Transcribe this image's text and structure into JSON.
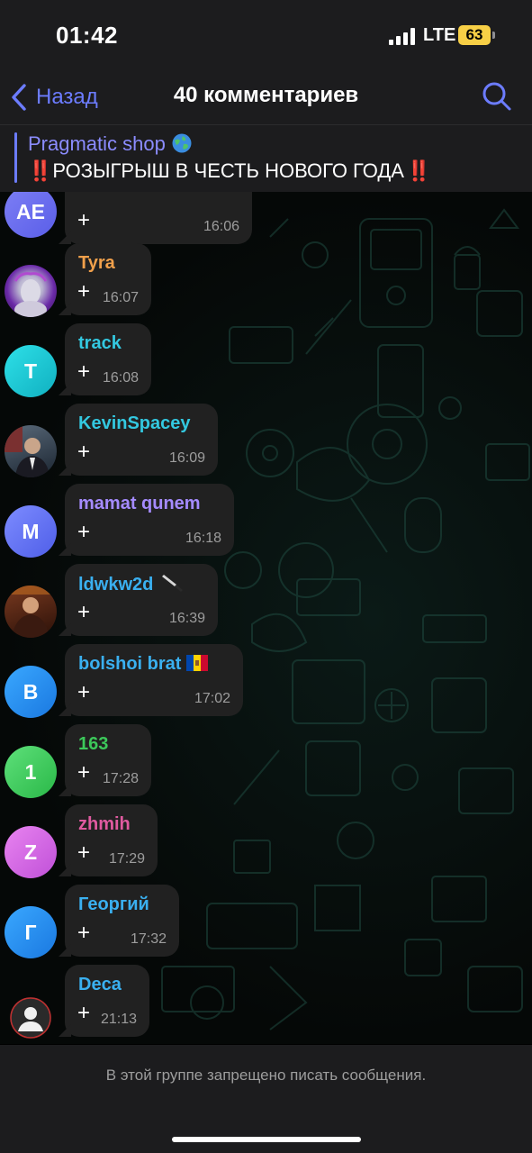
{
  "status": {
    "time": "01:42",
    "network": "LTE",
    "battery": "63"
  },
  "nav": {
    "back_label": "Назад",
    "title": "40 комментариев"
  },
  "pinned": {
    "title": "Pragmatic shop",
    "bang_left": "‼️",
    "text": "РОЗЫГРЫШ В ЧЕСТЬ НОВОГО ГОДА",
    "bang_right": "‼️"
  },
  "messages": [
    {
      "sender": "",
      "initials": "AE",
      "text": "+",
      "time": "16:06",
      "avatar_color": "#6a6cf0",
      "name_color": "#ffffff"
    },
    {
      "sender": "Tyra",
      "initials": "",
      "text": "+",
      "time": "16:07",
      "avatar_color": "#7a2fb0",
      "name_color": "#f0a04b"
    },
    {
      "sender": "track",
      "initials": "T",
      "text": "+",
      "time": "16:08",
      "avatar_color": "#17c8d4",
      "name_color": "#33c8e0"
    },
    {
      "sender": "KevinSpacey",
      "initials": "",
      "text": "+",
      "time": "16:09",
      "avatar_color": "#3a4a5a",
      "name_color": "#33c8e0"
    },
    {
      "sender": "mamat qunem",
      "initials": "M",
      "text": "+",
      "time": "16:18",
      "avatar_color": "#5a6cf0",
      "name_color": "#a58bff"
    },
    {
      "sender": "ldwkw2d",
      "initials": "",
      "text": "+",
      "time": "16:39",
      "avatar_color": "#5a2a1a",
      "name_color": "#3ab0f0"
    },
    {
      "sender": "bolshoi brat",
      "initials": "B",
      "text": "+",
      "time": "17:02",
      "avatar_color": "#1f8ef0",
      "name_color": "#3ab0f0"
    },
    {
      "sender": "163",
      "initials": "1",
      "text": "+",
      "time": "17:28",
      "avatar_color": "#3cc85a",
      "name_color": "#3cc85a"
    },
    {
      "sender": "zhmih",
      "initials": "Z",
      "text": "+",
      "time": "17:29",
      "avatar_color": "#d060e0",
      "name_color": "#e05aa0"
    },
    {
      "sender": "Георгий",
      "initials": "Г",
      "text": "+",
      "time": "17:32",
      "avatar_color": "#1f8ef0",
      "name_color": "#3ab0f0"
    },
    {
      "sender": "Deca",
      "initials": "",
      "text": "+",
      "time": "21:13",
      "avatar_color": "#e8e8e8",
      "name_color": "#3ab0f0"
    }
  ],
  "footer": {
    "restricted_text": "В этой группе запрещено писать сообщения."
  },
  "icons": {
    "back": "chevron-left-icon",
    "search": "search-icon",
    "globe": "globe-icon"
  },
  "colors": {
    "accent": "#6c7cff",
    "bubble": "#212121",
    "battery": "#f7cf46"
  }
}
